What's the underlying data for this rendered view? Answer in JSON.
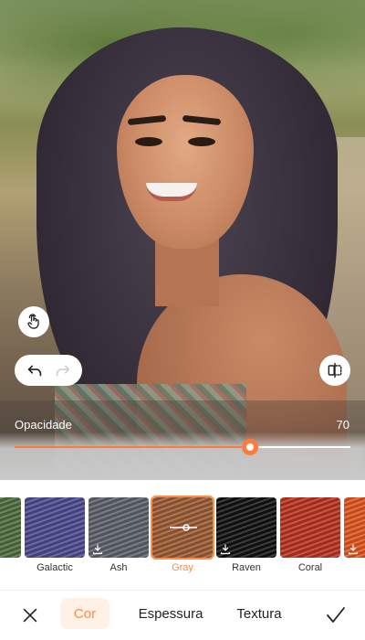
{
  "opacity": {
    "label": "Opacidade",
    "value": "70",
    "level_percent": 70,
    "accent_color": "#ff7a3d"
  },
  "controls": {
    "touch_icon": "hand-tap-icon",
    "undo_icon": "undo-icon",
    "redo_icon": "redo-icon",
    "compare_icon": "compare-icon"
  },
  "swatches": [
    {
      "name": "een",
      "color": "#4e6b3f",
      "selected": false,
      "downloadable": false
    },
    {
      "name": "Galactic",
      "color": "#4b4a8e",
      "selected": false,
      "downloadable": false
    },
    {
      "name": "Ash",
      "color": "#5c606a",
      "selected": false,
      "downloadable": true
    },
    {
      "name": "Gray",
      "color": "#9a5a32",
      "selected": true,
      "downloadable": false
    },
    {
      "name": "Raven",
      "color": "#111111",
      "selected": false,
      "downloadable": true
    },
    {
      "name": "Coral",
      "color": "#b8321f",
      "selected": false,
      "downloadable": false
    },
    {
      "name": "Co",
      "color": "#e0541c",
      "selected": false,
      "downloadable": true
    }
  ],
  "bottom_bar": {
    "close_icon": "close-icon",
    "tabs": [
      "Cor",
      "Espessura",
      "Textura"
    ],
    "active_tab": "Cor",
    "confirm_icon": "checkmark-icon",
    "accent_color": "#ff8a3d"
  }
}
